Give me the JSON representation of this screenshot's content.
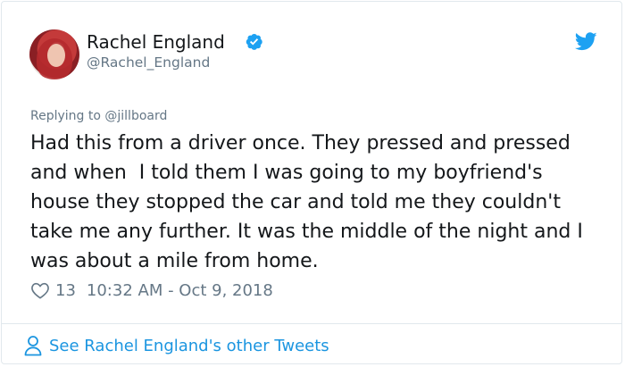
{
  "author": {
    "name": "Rachel England",
    "handle": "@Rachel_England",
    "verified": true
  },
  "reply": {
    "prefix": "Replying to",
    "to": "@jillboard"
  },
  "tweet": {
    "text": "Had this from a driver once. They pressed and pressed and when  I told them I was going to my boyfriend's house they stopped the car and told me they couldn't take me any further. It was the middle of the night and I was about a mile from home.",
    "likes": "13",
    "timestamp": "10:32 AM - Oct 9, 2018"
  },
  "footer": {
    "link_label": "See Rachel England's other Tweets"
  },
  "colors": {
    "accent": "#1da1f2",
    "link": "#1b95e0",
    "secondary_text": "#657786",
    "border": "#e1e8ed"
  },
  "icons": {
    "verified": "verified-badge-icon",
    "brand": "twitter-bird-icon",
    "like": "heart-icon",
    "profile": "person-icon"
  }
}
